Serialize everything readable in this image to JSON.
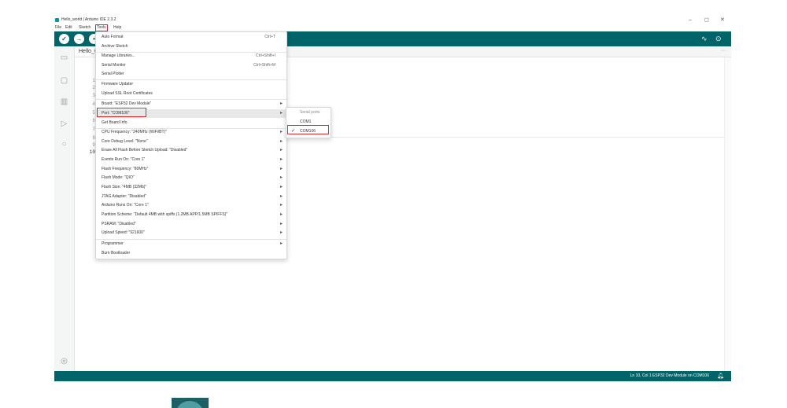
{
  "window": {
    "title": "Hello_world | Arduino IDE 2.3.2",
    "controls": {
      "minimize": "–",
      "maximize": "◻",
      "close": "✕"
    }
  },
  "menubar": {
    "items": [
      "File",
      "Edit",
      "Sketch",
      "Tools",
      "Help"
    ],
    "active": "Tools"
  },
  "toolbar": {
    "verify_icon": "check-icon",
    "upload_icon": "arrow-right-icon",
    "serial_plotter_icon": "pulse-icon",
    "serial_monitor_icon": "magnifier-icon"
  },
  "tab": {
    "label": "Hello_world",
    "more": "···"
  },
  "editor": {
    "line_numbers": [
      "1",
      "2",
      "3",
      "4",
      "5",
      "6",
      "7",
      "8",
      "9",
      "10"
    ]
  },
  "tools_menu": {
    "items": [
      {
        "label": "Auto Format",
        "shortcut": "Ctrl+T"
      },
      {
        "label": "Archive Sketch"
      },
      {
        "label": "Manage Libraries...",
        "shortcut": "Ctrl+Shift+I"
      },
      {
        "label": "Serial Monitor",
        "shortcut": "Ctrl+Shift+M"
      },
      {
        "label": "Serial Plotter"
      },
      {
        "label": "Firmware Updater"
      },
      {
        "label": "Upload SSL Root Certificates"
      },
      {
        "label": "Board: \"ESP32 Dev Module\"",
        "submenu": true
      },
      {
        "label": "Port: \"COM106\"",
        "submenu": true
      },
      {
        "label": "Get Board Info"
      },
      {
        "label": "CPU Frequency: \"240MHz (WiFi/BT)\"",
        "submenu": true
      },
      {
        "label": "Core Debug Level: \"None\"",
        "submenu": true
      },
      {
        "label": "Erase All Flash Before Sketch Upload: \"Disabled\"",
        "submenu": true
      },
      {
        "label": "Events Run On: \"Core 1\"",
        "submenu": true
      },
      {
        "label": "Flash Frequency: \"80MHz\"",
        "submenu": true
      },
      {
        "label": "Flash Mode: \"QIO\"",
        "submenu": true
      },
      {
        "label": "Flash Size: \"4MB (32Mb)\"",
        "submenu": true
      },
      {
        "label": "JTAG Adapter: \"Disabled\"",
        "submenu": true
      },
      {
        "label": "Arduino Runs On: \"Core 1\"",
        "submenu": true
      },
      {
        "label": "Partition Scheme: \"Default 4MB with spiffs (1.2MB APP/1.5MB SPIFFS)\"",
        "submenu": true
      },
      {
        "label": "PSRAM: \"Disabled\"",
        "submenu": true
      },
      {
        "label": "Upload Speed: \"921600\"",
        "submenu": true
      },
      {
        "label": "Programmer",
        "submenu": true
      },
      {
        "label": "Burn Bootloader"
      }
    ],
    "submenu_arrow": "▸"
  },
  "port_submenu": {
    "header": "Serial ports",
    "items": [
      {
        "label": "COM1",
        "checked": false
      },
      {
        "label": "COM106",
        "checked": true
      }
    ],
    "check_glyph": "✓"
  },
  "statusbar": {
    "text": "Ln 10, Col 1   ESP32 Dev Module on COM106",
    "bell_icon": "bell-icon"
  },
  "colors": {
    "teal": "#006468",
    "highlight_red": "#d9262d"
  }
}
